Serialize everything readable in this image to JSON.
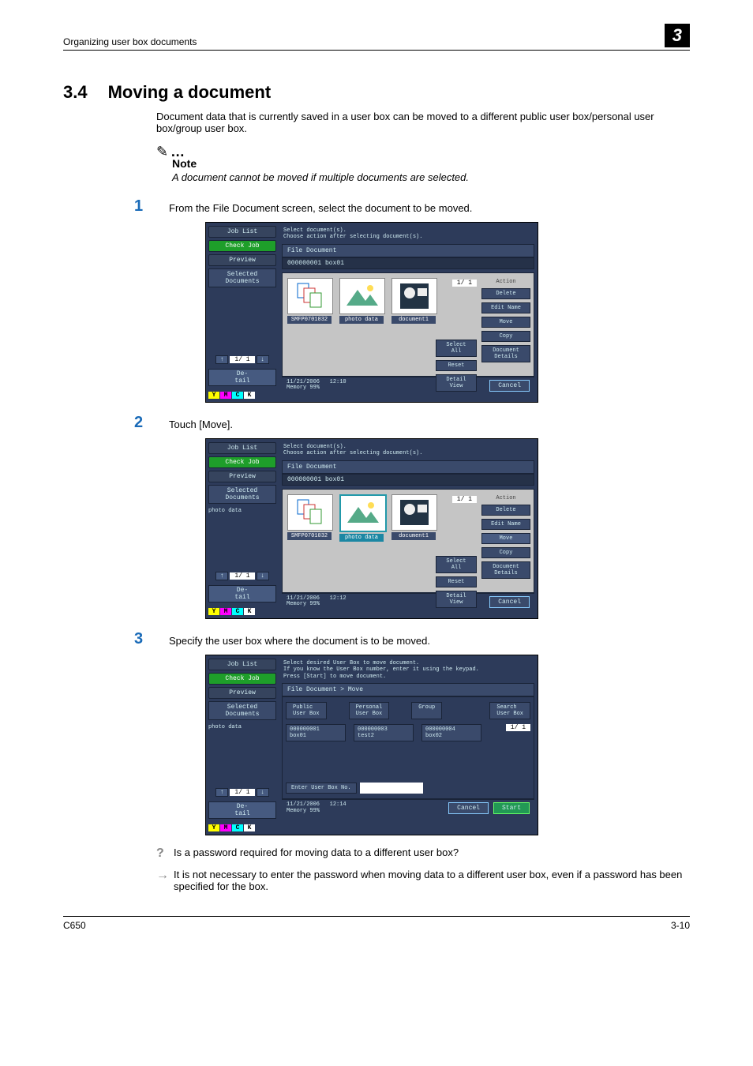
{
  "header": {
    "breadcrumb": "Organizing user box documents",
    "chapter": "3"
  },
  "section": {
    "number": "3.4",
    "title": "Moving a document"
  },
  "intro": "Document data that is currently saved in a user box can be moved to a different public user box/personal user box/group user box.",
  "note": {
    "label": "Note",
    "text": "A document cannot be moved if multiple documents are selected."
  },
  "steps": [
    {
      "n": "1",
      "text": "From the File Document screen, select the document to be moved."
    },
    {
      "n": "2",
      "text": "Touch [Move]."
    },
    {
      "n": "3",
      "text": "Specify the user box where the document is to be moved."
    }
  ],
  "qa": {
    "q": "Is a password required for moving data to a different user box?",
    "a": "It is not necessary to enter the password when moving data to a different user box, even if a password has been specified for the box."
  },
  "footer": {
    "left": "C650",
    "right": "3-10"
  },
  "panel_common": {
    "sidebar": {
      "job_list": "Job List",
      "check_job": "Check Job",
      "preview": "Preview",
      "selected": "Selected Documents",
      "detail": "De-\ntail",
      "page": "1/  1",
      "ymck": {
        "y": "Y",
        "m": "M",
        "c": "C",
        "k": "K"
      }
    },
    "right": {
      "action": "Action",
      "delete": "Delete",
      "edit": "Edit Name",
      "move": "Move",
      "copy": "Copy",
      "details": "Document\nDetails",
      "select_all": "Select\nAll",
      "reset": "Reset",
      "detail_view": "Detail\nView"
    },
    "tab": "File Document",
    "tabbar": "000000001   box01",
    "page_ind": "1/  1",
    "thumbs": [
      {
        "name": "SMFP0701032"
      },
      {
        "name": "photo data"
      },
      {
        "name": "document1"
      }
    ],
    "cancel": "Cancel"
  },
  "panel1": {
    "top": "Select document(s).\nChoose action after selecting document(s).",
    "selected_list": "",
    "time": "12:10",
    "date": "11/21/2006",
    "mem": "Memory      99%"
  },
  "panel2": {
    "top": "Select document(s).\nChoose action after selecting document(s).",
    "selected_list": "photo data",
    "time": "12:12",
    "date": "11/21/2006",
    "mem": "Memory      99%"
  },
  "panel3": {
    "top": "Select desired User Box to move document.\nIf you know the User Box number, enter it using the keypad.\nPress [Start] to move document.",
    "tab": "File Document > Move",
    "selected_list": "photo data",
    "cats": [
      "Public\nUser Box",
      "Personal\nUser Box",
      "Group",
      "Search\nUser Box"
    ],
    "boxes": [
      {
        "no": "000000001",
        "name": "box01"
      },
      {
        "no": "000000003",
        "name": "test2"
      },
      {
        "no": "000000004",
        "name": "box02"
      }
    ],
    "enter": "Enter User Box No.",
    "page_ind": "1/  1",
    "cancel": "Cancel",
    "start": "Start",
    "time": "12:14",
    "date": "11/21/2006",
    "mem": "Memory      99%"
  }
}
